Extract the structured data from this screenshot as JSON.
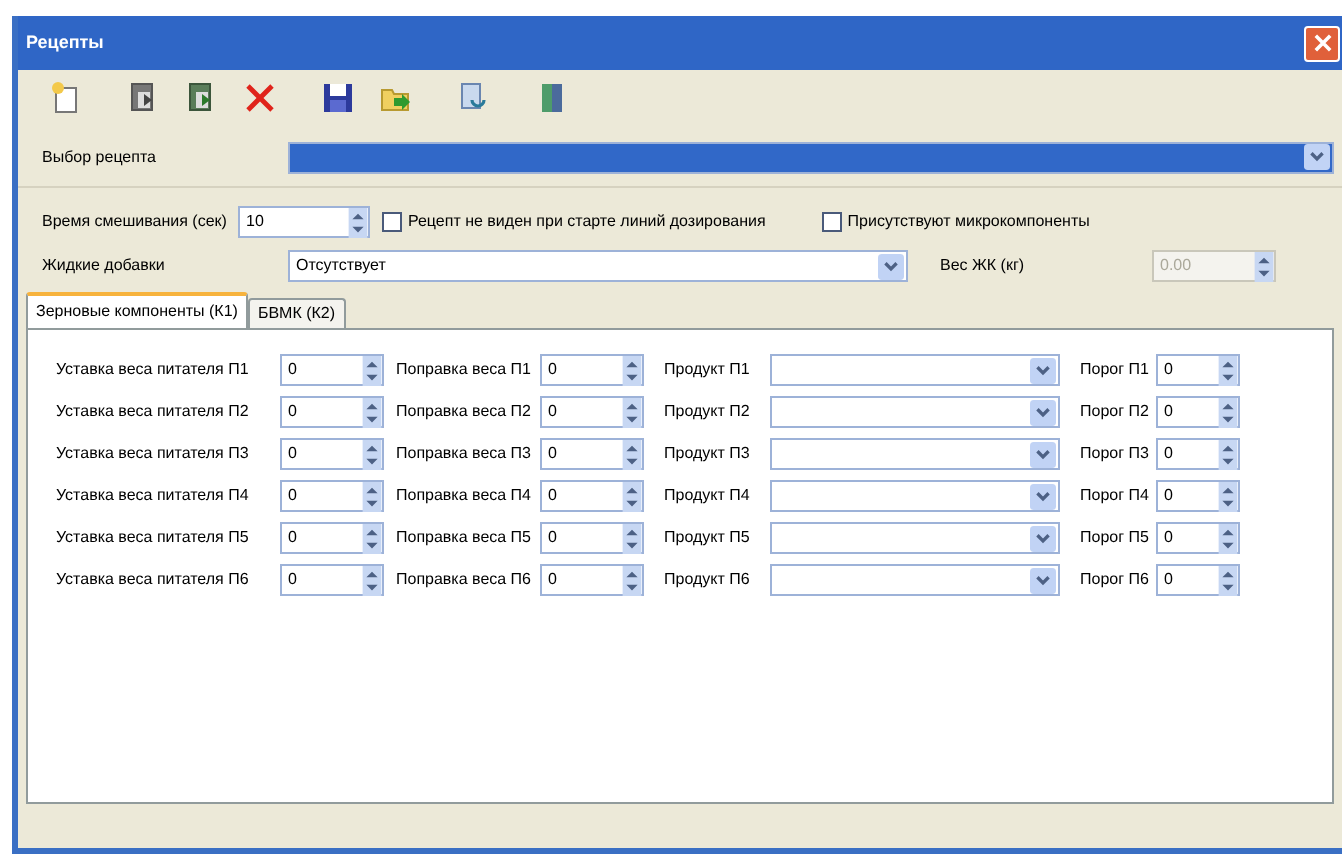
{
  "window": {
    "title": "Рецепты"
  },
  "toolbar": [
    {
      "kind": "new"
    },
    {
      "kind": "copy"
    },
    {
      "kind": "paste"
    },
    {
      "kind": "delete"
    },
    {
      "kind": "save"
    },
    {
      "kind": "open"
    },
    {
      "kind": "refresh"
    },
    {
      "kind": "exit"
    }
  ],
  "recipe_select": {
    "label": "Выбор рецепта",
    "selected": true
  },
  "mix_time": {
    "label": "Время смешивания (сек)",
    "value": "10"
  },
  "checkboxes": [
    {
      "label": "Рецепт не виден при старте линий дозирования",
      "checked": false
    },
    {
      "label": "Присутствуют микрокомпоненты",
      "checked": false
    }
  ],
  "liquid": {
    "label": "Жидкие добавки",
    "value": "Отсутствует"
  },
  "liquid_weight": {
    "label": "Вес ЖК (кг)",
    "value": "0.00",
    "disabled": true
  },
  "tabs": [
    {
      "label": "Зерновые компоненты (К1)",
      "selected": true
    },
    {
      "label": "БВМК (К2)",
      "selected": false
    }
  ],
  "rows": [
    {
      "setpoint_label": "Уставка веса питателя П1",
      "setpoint": "0",
      "correction_label": "Поправка веса П1",
      "correction": "0",
      "product_label": "Продукт П1",
      "threshold_label": "Порог П1",
      "threshold": "0"
    },
    {
      "setpoint_label": "Уставка веса питателя П2",
      "setpoint": "0",
      "correction_label": "Поправка веса П2",
      "correction": "0",
      "product_label": "Продукт П2",
      "threshold_label": "Порог П2",
      "threshold": "0"
    },
    {
      "setpoint_label": "Уставка веса питателя П3",
      "setpoint": "0",
      "correction_label": "Поправка веса П3",
      "correction": "0",
      "product_label": "Продукт П3",
      "threshold_label": "Порог П3",
      "threshold": "0"
    },
    {
      "setpoint_label": "Уставка веса питателя П4",
      "setpoint": "0",
      "correction_label": "Поправка веса П4",
      "correction": "0",
      "product_label": "Продукт П4",
      "threshold_label": "Порог П4",
      "threshold": "0"
    },
    {
      "setpoint_label": "Уставка веса питателя П5",
      "setpoint": "0",
      "correction_label": "Поправка веса П5",
      "correction": "0",
      "product_label": "Продукт П5",
      "threshold_label": "Порог П5",
      "threshold": "0"
    },
    {
      "setpoint_label": "Уставка веса питателя П6",
      "setpoint": "0",
      "correction_label": "Поправка веса П6",
      "correction": "0",
      "product_label": "Продукт П6",
      "threshold_label": "Порог П6",
      "threshold": "0"
    }
  ]
}
